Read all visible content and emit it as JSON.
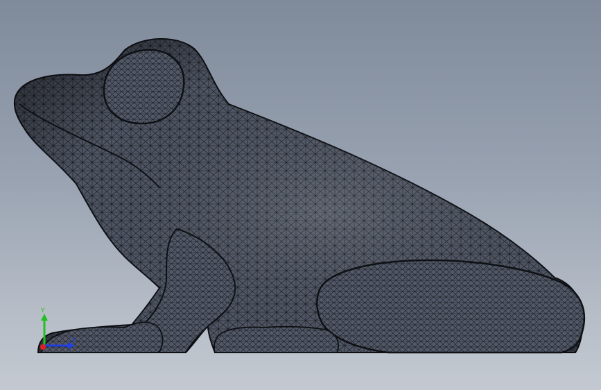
{
  "viewport": {
    "background_top": "#7f8a9a",
    "background_bottom": "#c4c9d1"
  },
  "model": {
    "name": "frog",
    "display_mode": "shaded-with-edges",
    "fill_color": "#4f5563",
    "edge_color": "#15181d"
  },
  "triad": {
    "y_label": "Y",
    "x_label": "X",
    "y_color": "#20c020",
    "x_color": "#2040e0",
    "z_color": "#e02020"
  }
}
